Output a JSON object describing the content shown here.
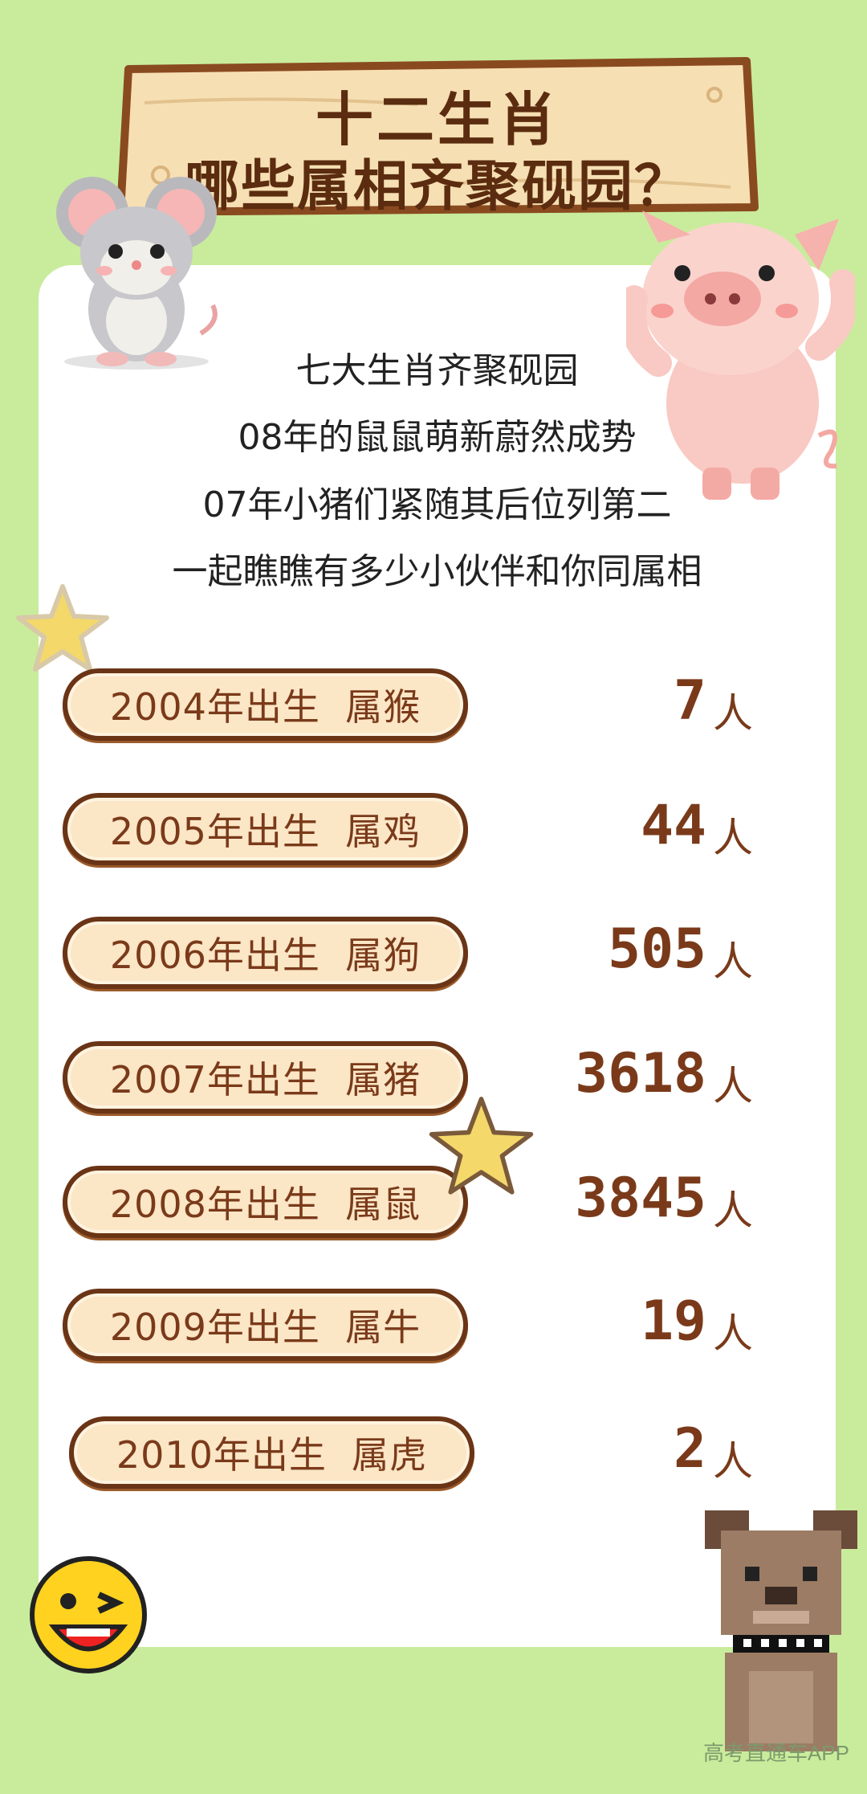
{
  "title": {
    "line1": "十二生肖",
    "line2": "哪些属相齐聚砚园？"
  },
  "intro": [
    "七大生肖齐聚砚园",
    "08年的鼠鼠萌新蔚然成势",
    "07年小猪们紧随其后位列第二",
    "一起瞧瞧有多少小伙伴和你同属相"
  ],
  "rows": [
    {
      "label": "2004年出生  属猴",
      "count": "7",
      "unit": "人"
    },
    {
      "label": "2005年出生  属鸡",
      "count": "44",
      "unit": "人"
    },
    {
      "label": "2006年出生  属狗",
      "count": "505",
      "unit": "人"
    },
    {
      "label": "2007年出生  属猪",
      "count": "3618",
      "unit": "人"
    },
    {
      "label": "2008年出生  属鼠",
      "count": "3845",
      "unit": "人"
    },
    {
      "label": "2009年出生  属牛",
      "count": "19",
      "unit": "人"
    },
    {
      "label": "2010年出生  属虎",
      "count": "2",
      "unit": "人"
    }
  ],
  "watermark": "高考直通车APP",
  "colors": {
    "background": "#c9ec9c",
    "card": "#ffffff",
    "wood": "#f6dfb3",
    "accent": "#7a3a1a"
  },
  "decorations": [
    "mouse-icon",
    "pig-icon",
    "star-icon",
    "winking-smiley-icon",
    "dog-icon"
  ]
}
